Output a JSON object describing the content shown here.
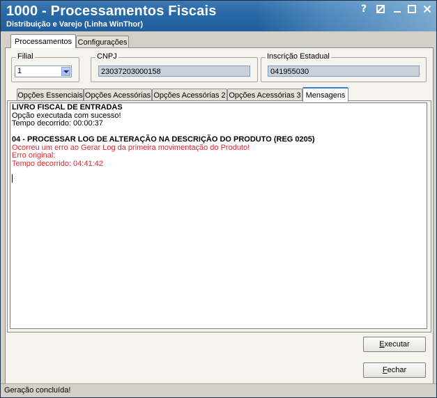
{
  "window": {
    "title": "1000 - Processamentos Fiscais",
    "subtitle": "Distribuição e Varejo (Linha WinThor)",
    "controls": {
      "help": "?",
      "restore": "▣",
      "minimize": "—",
      "maximize": "☐",
      "close": "✕"
    }
  },
  "main_tabs": [
    {
      "label": "Processamentos",
      "active": true
    },
    {
      "label": "Configurações",
      "active": false
    }
  ],
  "filters": {
    "filial": {
      "label": "Filial",
      "value": "1"
    },
    "cnpj": {
      "label": "CNPJ",
      "value": "23037203000158"
    },
    "inscricao": {
      "label": "Inscrição Estadual",
      "value": "041955030"
    }
  },
  "sub_tabs": [
    {
      "label": "Opções Essenciais",
      "active": false
    },
    {
      "label": "Opções Acessórias",
      "active": false
    },
    {
      "label": "Opções Acessórias 2",
      "active": false
    },
    {
      "label": "Opções Acessórias 3",
      "active": false
    },
    {
      "label": "Mensagens",
      "active": true
    }
  ],
  "messages": [
    {
      "text": "LIVRO FISCAL DE ENTRADAS",
      "style": "bold"
    },
    {
      "text": "Opção executada com sucesso!",
      "style": "normal"
    },
    {
      "text": "Tempo decorrido: 00:00:37",
      "style": "normal"
    },
    {
      "text": "",
      "style": "normal"
    },
    {
      "text": "04 - PROCESSAR LOG DE ALTERAÇÃO NA DESCRIÇÃO DO PRODUTO (REG 0205)",
      "style": "bold"
    },
    {
      "text": "Ocorreu um erro ao Gerar Log da primeira movimentação do Produto!",
      "style": "red"
    },
    {
      "text": "Erro original:",
      "style": "red"
    },
    {
      "text": "Tempo decorrido: 04:41:42",
      "style": "red"
    }
  ],
  "buttons": {
    "executar": {
      "label_first": "E",
      "label_rest": "xecutar"
    },
    "fechar": {
      "label_first": "F",
      "label_rest": "echar"
    }
  },
  "status": "Geração concluída!",
  "colors": {
    "title_bar": "#2b6aa8",
    "error_text": "#e0262f",
    "readonly_field": "#c8d1dc"
  }
}
